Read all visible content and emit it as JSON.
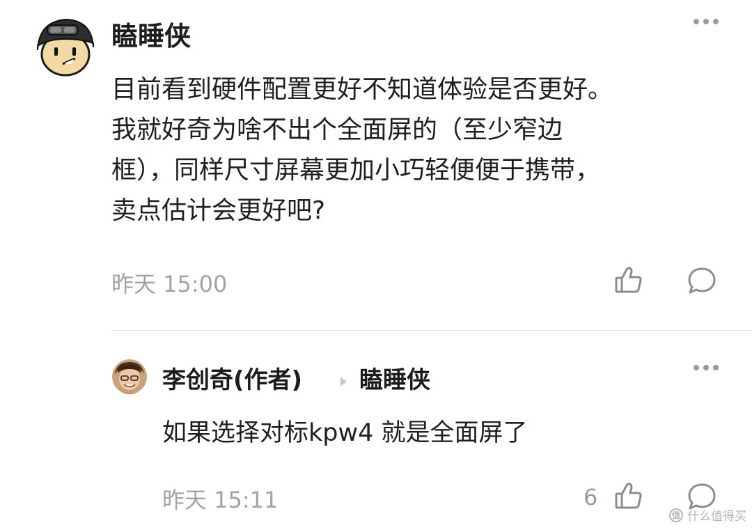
{
  "comments": [
    {
      "username": "瞌睡侠",
      "avatar": "helmet-character-avatar",
      "lines": [
        "目前看到硬件配置更好不知道体验是否更好。",
        "我就好奇为啥不出个全面屏的（至少窄边",
        "框），同样尺寸屏幕更加小巧轻便便于携带，",
        "卖点估计会更好吧?"
      ],
      "timestamp": "昨天 15:00",
      "like_icon": "thumbs-up-icon",
      "reply_icon": "comment-bubble-icon",
      "more_icon": "more-dots-icon"
    }
  ],
  "reply": {
    "username": "李创奇(作者)",
    "reply_to": "瞌睡侠",
    "avatar": "person-photo-avatar",
    "text": "如果选择对标kpw4 就是全面屏了",
    "timestamp": "昨天 15:11",
    "like_count": "6",
    "like_icon": "thumbs-up-icon",
    "reply_icon": "comment-bubble-icon",
    "more_icon": "more-dots-icon"
  },
  "watermark": {
    "logo": "值",
    "text": "什么值得买"
  }
}
